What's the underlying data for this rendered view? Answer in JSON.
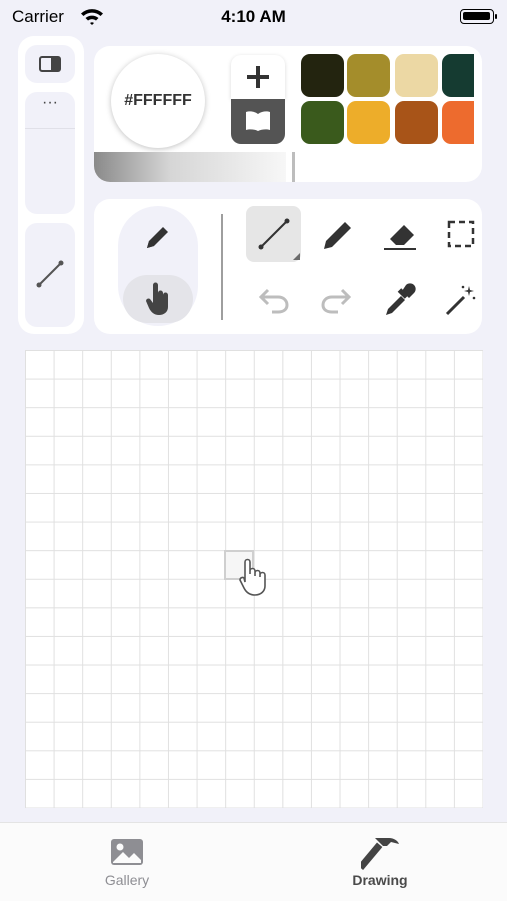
{
  "status_bar": {
    "carrier": "Carrier",
    "time": "4:10 AM"
  },
  "left_panel": {
    "more_label": "···"
  },
  "color_panel": {
    "current_color_hex": "#FFFFFF",
    "add_icon": "plus-icon",
    "library_icon": "book-icon",
    "swatches": [
      "#23240f",
      "#a48d2b",
      "#ecd8a4",
      "#153b31",
      "#3a5a1c",
      "#edad2a",
      "#a85418",
      "#ed6b2e"
    ]
  },
  "tools_panel": {
    "modes": [
      "pencil-icon",
      "hand-pointer-icon"
    ],
    "tools": [
      "line-tool-icon",
      "pencil-icon",
      "eraser-icon",
      "rect-select-icon",
      "undo-icon",
      "redo-icon",
      "eyedropper-icon",
      "magic-wand-icon"
    ],
    "selected_tool": "line-tool-icon"
  },
  "tab_bar": {
    "tabs": [
      {
        "label": "Gallery",
        "icon": "photo-icon",
        "active": false
      },
      {
        "label": "Drawing",
        "icon": "hammer-icon",
        "active": true
      }
    ]
  }
}
